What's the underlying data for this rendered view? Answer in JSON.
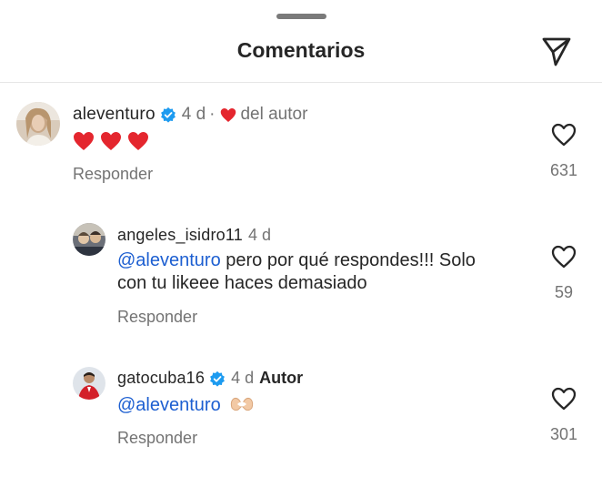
{
  "header": {
    "title": "Comentarios"
  },
  "comments": [
    {
      "username": "aleventuro",
      "verified": true,
      "age": "4 d",
      "separator": "·",
      "author_like": "del autor",
      "text_emojis": "❤️❤️❤️",
      "reply_label": "Responder",
      "likes": "631"
    },
    {
      "username": "angeles_isidro11",
      "verified": false,
      "age": "4 d",
      "mention": "@aleventuro",
      "text_line1": " pero por qué respondes!!! Solo",
      "text_line2": "con tu likeee haces demasiado",
      "reply_label": "Responder",
      "likes": "59"
    },
    {
      "username": "gatocuba16",
      "verified": true,
      "age": "4 d",
      "author_tag": "Autor",
      "mention": "@aleventuro",
      "text_emoji": "🫶🏼",
      "reply_label": "Responder",
      "likes": "301"
    }
  ],
  "icons": {
    "send": "paper-plane-icon",
    "like": "heart-outline-icon",
    "verified": "verified-badge-icon",
    "author_liked": "red-heart-icon"
  },
  "colors": {
    "mention": "#1d5fd1",
    "verified": "#1d9bf0",
    "heart_red": "#e4262e",
    "muted_text": "#737373"
  }
}
